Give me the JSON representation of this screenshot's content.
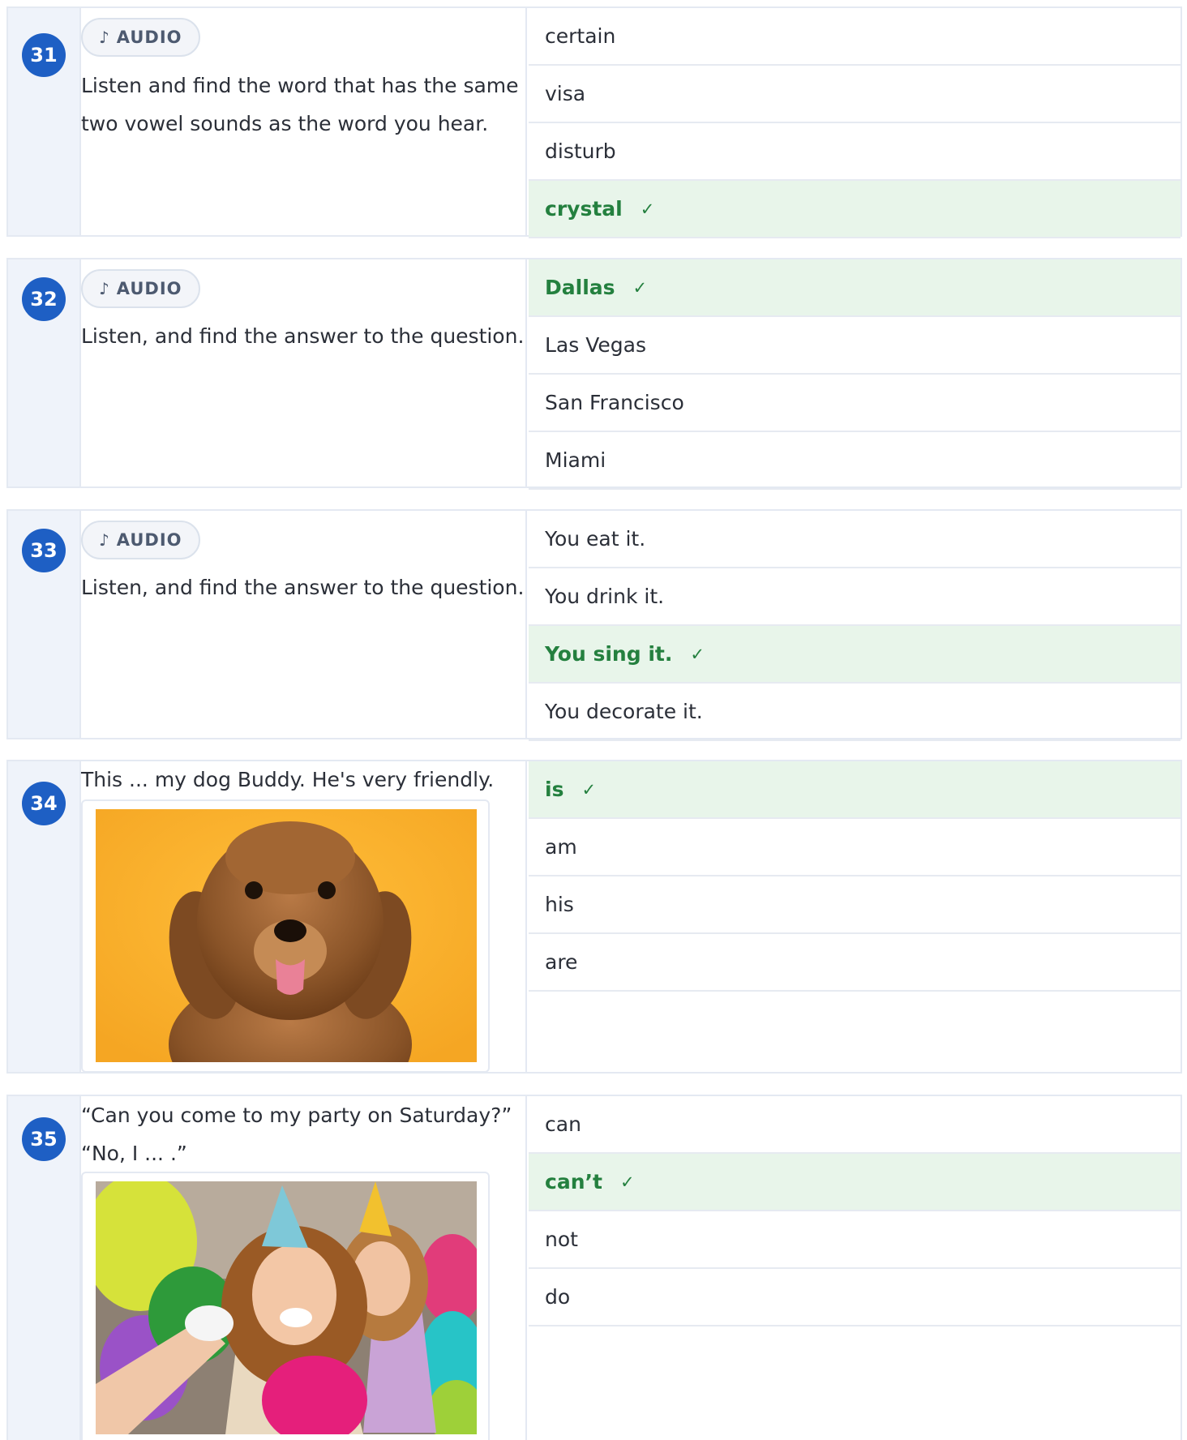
{
  "audio_label": "AUDIO",
  "check_mark": "✓",
  "questions": [
    {
      "number": "31",
      "prompt": "Listen and find the word that has the same two vowel sounds as the word you hear.",
      "options": [
        "certain",
        "visa",
        "disturb",
        "crystal"
      ],
      "correct_index": 3
    },
    {
      "number": "32",
      "prompt": "Listen, and find the answer to the question.",
      "options": [
        "Dallas",
        "Las Vegas",
        "San Francisco",
        "Miami"
      ],
      "correct_index": 0
    },
    {
      "number": "33",
      "prompt": "Listen, and find the answer to the question.",
      "options": [
        "You eat it.",
        "You drink it.",
        "You sing it.",
        "You decorate it."
      ],
      "correct_index": 2
    },
    {
      "number": "34",
      "prompt": "This ... my dog Buddy. He's very friendly.",
      "image": "dog-photo",
      "options": [
        "is",
        "am",
        "his",
        "are"
      ],
      "correct_index": 0
    },
    {
      "number": "35",
      "prompt_line1": "“Can you come to my party on Saturday?”",
      "prompt_line2": "“No, I ... .”",
      "image": "party-photo",
      "options": [
        "can",
        "can’t",
        "not",
        "do"
      ],
      "correct_index": 1
    }
  ]
}
